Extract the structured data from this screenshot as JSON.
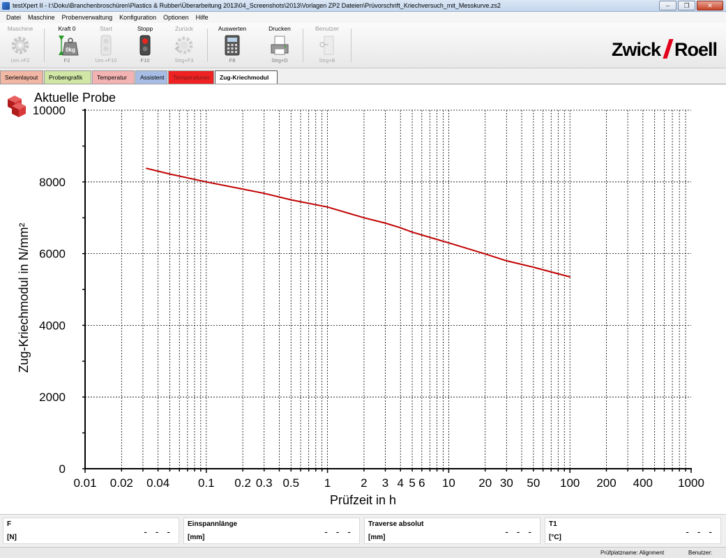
{
  "window": {
    "title": "testXpert II  - I:\\Doku\\Branchenbroschüren\\Plastics & Rubber\\Überarbeitung 2013\\04_Screenshots\\2013\\Vorlagen ZP2 Dateien\\Prüvorschrift_Kriechversuch_mit_Messkurve.zs2"
  },
  "menu": [
    "Datei",
    "Maschine",
    "Probenverwaltung",
    "Konfiguration",
    "Optionen",
    "Hilfe"
  ],
  "toolbar": {
    "maschine": {
      "label": "Maschine",
      "key": "Um.+F2"
    },
    "kraft0": {
      "label": "Kraft 0",
      "key": "F2",
      "icon_text": "0kg"
    },
    "start": {
      "label": "Start",
      "key": "Um.+F10"
    },
    "stopp": {
      "label": "Stopp",
      "key": "F10"
    },
    "zurueck": {
      "label": "Zurück",
      "key": "Strg+F3"
    },
    "auswerten": {
      "label": "Auswerten",
      "key": "F8"
    },
    "drucken": {
      "label": "Drucken",
      "key": "Strg+D"
    },
    "benutzer": {
      "label": "Benutzer",
      "key": "Strg+B"
    }
  },
  "logo": {
    "left": "Zwick",
    "right": "Roell"
  },
  "tabs": [
    "Serienlayout",
    "Probengrafik",
    "Temperatur",
    "Assistent",
    "Temperaturen",
    "Zug-Kriechmodul"
  ],
  "probe_title": "Aktuelle Probe",
  "chart_data": {
    "type": "line",
    "xscale": "log",
    "xlim": [
      0.01,
      1000
    ],
    "ylim": [
      0,
      10000
    ],
    "xlabel": "Prüfzeit in h",
    "ylabel": "Zug-Kriechmodul in N/mm²",
    "x_ticks": [
      0.01,
      0.02,
      0.04,
      0.1,
      0.2,
      0.3,
      0.5,
      1,
      2,
      3,
      4,
      5,
      6,
      10,
      20,
      30,
      50,
      100,
      200,
      400,
      1000
    ],
    "x_tick_labels": [
      "0.01",
      "0.02",
      "0.04",
      "0.1",
      "0.2",
      "0.3",
      "0.5",
      "1",
      "2",
      "3",
      "4",
      "5",
      "6",
      "10",
      "20",
      "30",
      "50",
      "100",
      "200",
      "400",
      "1000"
    ],
    "y_ticks": [
      0,
      2000,
      4000,
      6000,
      8000,
      10000
    ],
    "y_tick_labels": [
      "0",
      "2000",
      "4000",
      "6000",
      "8000",
      "10000"
    ],
    "grid": true,
    "line_color": "#c00000",
    "series": [
      {
        "x": [
          0.032,
          0.05,
          0.1,
          0.2,
          0.3,
          0.5,
          1,
          2,
          3,
          4,
          5,
          10,
          20,
          30,
          50,
          100
        ],
        "y": [
          8380,
          8220,
          8000,
          7800,
          7680,
          7500,
          7300,
          7000,
          6850,
          6720,
          6600,
          6300,
          5990,
          5800,
          5620,
          5350
        ]
      }
    ]
  },
  "status": [
    {
      "label": "F",
      "unit": "[N]",
      "value": "- - -"
    },
    {
      "label": "Einspannlänge",
      "unit": "[mm]",
      "value": "- - -"
    },
    {
      "label": "Traverse absolut",
      "unit": "[mm]",
      "value": "- - -"
    },
    {
      "label": "T1",
      "unit": "[°C]",
      "value": "- - -"
    }
  ],
  "bottombar": {
    "workstation": "Prüfplatzname: Alignment",
    "user": "Benutzer:"
  }
}
